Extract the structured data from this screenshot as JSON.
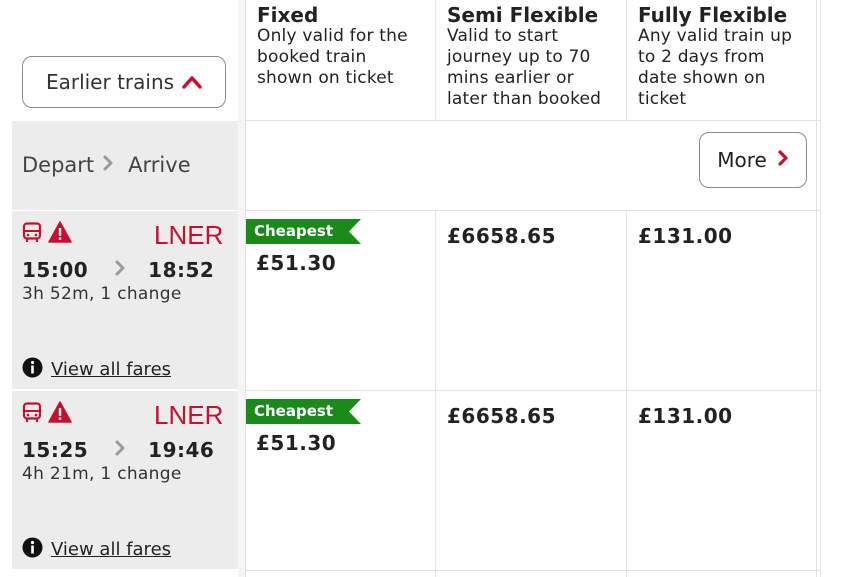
{
  "controls": {
    "earlier_label": "Earlier trains",
    "more_label": "More"
  },
  "header": {
    "depart_label": "Depart",
    "arrive_label": "Arrive"
  },
  "fare_columns": [
    {
      "title": "Fixed",
      "desc": [
        "Only valid for the",
        "booked train",
        "shown on ticket"
      ]
    },
    {
      "title": "Semi Flexible",
      "desc": [
        "Valid to start",
        "journey up to 70",
        "mins earlier or",
        "later than booked"
      ]
    },
    {
      "title": "Fully Flexible",
      "desc": [
        "Any valid train up",
        "to 2 days from",
        "date shown on",
        "ticket"
      ]
    }
  ],
  "journeys": [
    {
      "operator": "LNER",
      "depart": "15:00",
      "arrive": "18:52",
      "duration": "3h 52m, 1 change",
      "view_fares_label": "View all fares",
      "cheapest_label": "Cheapest",
      "fares": [
        "£51.30",
        "£6658.65",
        "£131.00"
      ]
    },
    {
      "operator": "LNER",
      "depart": "15:25",
      "arrive": "19:46",
      "duration": "4h 21m, 1 change",
      "view_fares_label": "View all fares",
      "cheapest_label": "Cheapest",
      "fares": [
        "£51.30",
        "£6658.65",
        "£131.00"
      ]
    }
  ],
  "colors": {
    "accent_red": "#c8102e",
    "cheapest_green": "#1a8a1a",
    "row_grey": "#ececec"
  },
  "icons": [
    "chevron-up-icon",
    "chevron-right-icon",
    "bus-icon",
    "warning-icon",
    "info-icon"
  ]
}
